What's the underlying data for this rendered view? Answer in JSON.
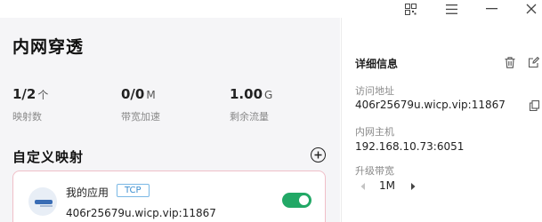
{
  "window": {
    "controls": [
      "qr-code-icon",
      "menu-icon",
      "minimize-icon",
      "close-icon"
    ]
  },
  "main": {
    "title": "内网穿透",
    "stats": [
      {
        "value": "1/2",
        "unit": "个",
        "label": "映射数"
      },
      {
        "value": "0/0",
        "unit": "M",
        "label": "带宽加速"
      },
      {
        "value": "1.00",
        "unit": "G",
        "label": "剩余流量"
      }
    ],
    "section_title": "自定义映射",
    "mapping": {
      "name": "我的应用",
      "protocol": "TCP",
      "address": "406r25679u.wicp.vip:11867",
      "enabled": true,
      "accent": "#22a866"
    }
  },
  "detail": {
    "title": "详细信息",
    "access_label": "访问地址",
    "access_value": "406r25679u.wicp.vip:11867",
    "host_label": "内网主机",
    "host_value": "192.168.10.73:6051",
    "bandwidth_label": "升级带宽",
    "bandwidth_value": "1M"
  }
}
